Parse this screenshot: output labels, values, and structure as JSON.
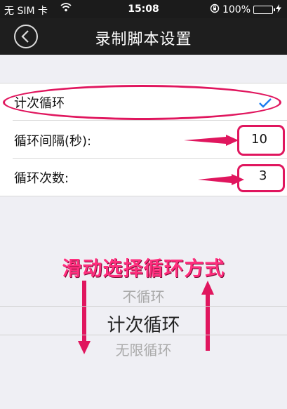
{
  "status_bar": {
    "carrier": "无 SIM 卡",
    "time": "15:08",
    "battery": "100%"
  },
  "nav": {
    "title": "录制脚本设置"
  },
  "settings": {
    "mode_label": "计次循环",
    "interval_label": "循环间隔(秒):",
    "interval_value": "10",
    "count_label": "循环次数:",
    "count_value": "3"
  },
  "annotation": {
    "caption": "滑动选择循环方式"
  },
  "picker": {
    "options": [
      "不循环",
      "计次循环",
      "无限循环"
    ],
    "selected_index": 1
  },
  "colors": {
    "accent": "#1a7cf0",
    "annotation": "#e0165e"
  }
}
